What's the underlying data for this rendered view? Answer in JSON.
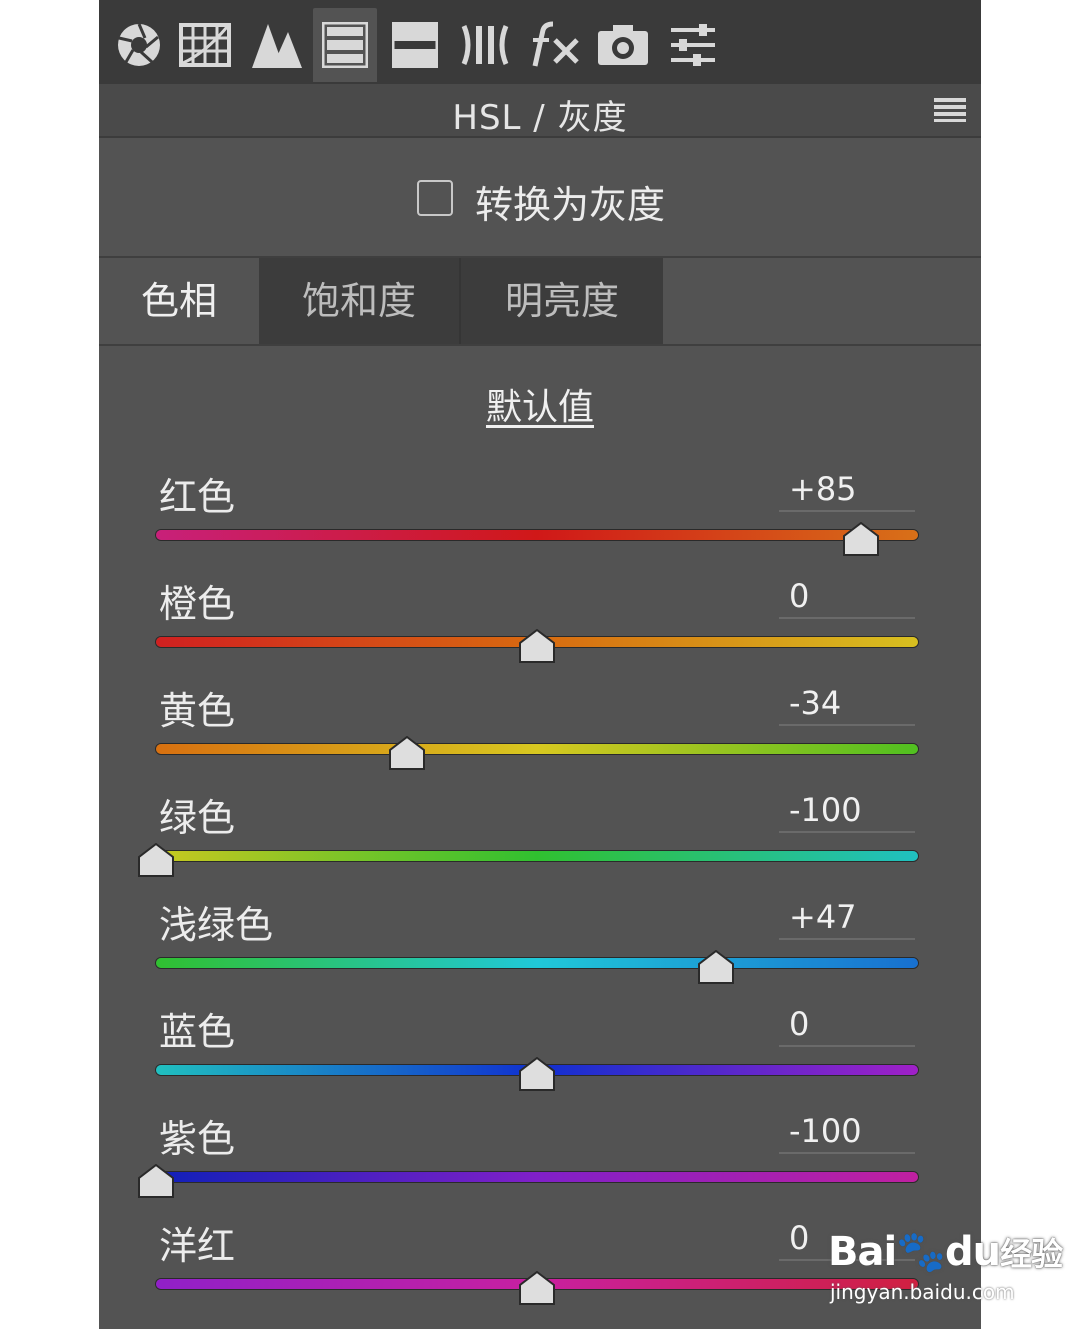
{
  "toolbar": {
    "tools": [
      {
        "icon": "aperture-icon"
      },
      {
        "icon": "tone-curve-icon"
      },
      {
        "icon": "detail-icon"
      },
      {
        "icon": "hsl-icon"
      },
      {
        "icon": "split-toning-icon"
      },
      {
        "icon": "lens-corrections-icon"
      },
      {
        "icon": "fx-icon"
      },
      {
        "icon": "camera-calibration-icon"
      },
      {
        "icon": "presets-icon"
      }
    ],
    "active_index": 3,
    "icon_color": "#d8d8d8"
  },
  "panel": {
    "title": "HSL / 灰度",
    "convert_gray_label": "转换为灰度",
    "convert_gray_checked": false
  },
  "tabs": [
    {
      "label": "色相",
      "active": true
    },
    {
      "label": "饱和度",
      "active": false
    },
    {
      "label": "明亮度",
      "active": false
    }
  ],
  "default_label": "默认值",
  "sliders": [
    {
      "label": "红色",
      "value": "+85",
      "num": 85,
      "colors": [
        "#c8207a",
        "#d01818",
        "#d87018"
      ]
    },
    {
      "label": "橙色",
      "value": "0",
      "num": 0,
      "colors": [
        "#d02020",
        "#d86a10",
        "#d8c020"
      ]
    },
    {
      "label": "黄色",
      "value": "-34",
      "num": -34,
      "colors": [
        "#d87010",
        "#d8c820",
        "#50c020"
      ]
    },
    {
      "label": "绿色",
      "value": "-100",
      "num": -100,
      "colors": [
        "#c8c820",
        "#30c030",
        "#20c0c0"
      ]
    },
    {
      "label": "浅绿色",
      "value": "+47",
      "num": 47,
      "colors": [
        "#30c030",
        "#20c8d8",
        "#1870d0"
      ]
    },
    {
      "label": "蓝色",
      "value": "0",
      "num": 0,
      "colors": [
        "#20c0c0",
        "#1030d0",
        "#a020c8"
      ]
    },
    {
      "label": "紫色",
      "value": "-100",
      "num": -100,
      "colors": [
        "#1020b8",
        "#8020c8",
        "#c020a0"
      ]
    },
    {
      "label": "洋红",
      "value": "0",
      "num": 0,
      "colors": [
        "#9020c8",
        "#c820a0",
        "#d02040"
      ]
    }
  ],
  "watermark": {
    "logo": "Bai",
    "logo_tail": "du",
    "logo_suffix": "经验",
    "url": "jingyan.baidu.com"
  }
}
